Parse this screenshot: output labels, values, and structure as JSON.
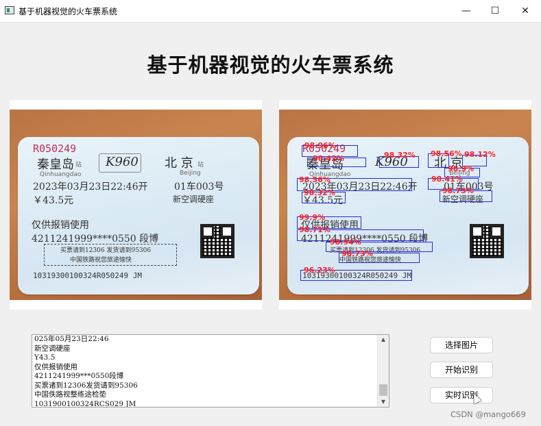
{
  "window": {
    "title": "基于机器视觉的火车票系统",
    "minimize": "—",
    "maximize": "☐",
    "close": "✕"
  },
  "page_title": "基于机器视觉的火车票系统",
  "ticket": {
    "serial": "R050249",
    "from_station": "秦皇岛",
    "from_pinyin": "Qinhuangdao",
    "station_suffix": "站",
    "train_no": "K960",
    "to_station": "北 京",
    "to_pinyin": "Beijing",
    "datetime": "2023年03月23日22:46开",
    "seat": "01车003号",
    "price": "￥43.5元",
    "seat_type": "新空调硬座",
    "notice1": "仅供报销使用",
    "id_name": "4211241999****0550 段博",
    "notice2": "买票请到12306 发货请到95306",
    "notice3": "中国铁路祝您旅途愉快",
    "code": "10319300100324R050249 JM"
  },
  "detections": [
    {
      "label": "98.96%"
    },
    {
      "label": "98.42%"
    },
    {
      "label": "98.32%"
    },
    {
      "label": "98.56%"
    },
    {
      "label": "98.12%"
    },
    {
      "label": "98.9%"
    },
    {
      "label": "98.56%"
    },
    {
      "label": "98.41%"
    },
    {
      "label": "98.32%"
    },
    {
      "label": "98.73%"
    },
    {
      "label": "99.9%"
    },
    {
      "label": "98.71%"
    },
    {
      "label": "98.94%"
    },
    {
      "label": "98.73%"
    },
    {
      "label": "96.23%"
    }
  ],
  "result_text": {
    "lines": [
      "025年05月23日22:46",
      "新空调硬座",
      "Y43.5",
      "仅供报销使用",
      "4211241999***0550段博",
      "买票诸到12306发货请到95306",
      "中国佚路视整练途检垫",
      "1031900100324RCS029 JM"
    ]
  },
  "buttons": {
    "select_image": "选择图片",
    "start_recognize": "开始识别",
    "realtime_recognize": "实时识别"
  },
  "scrollbar": {
    "up": "▲",
    "down": "▼"
  },
  "watermark": "CSDN @mango669"
}
